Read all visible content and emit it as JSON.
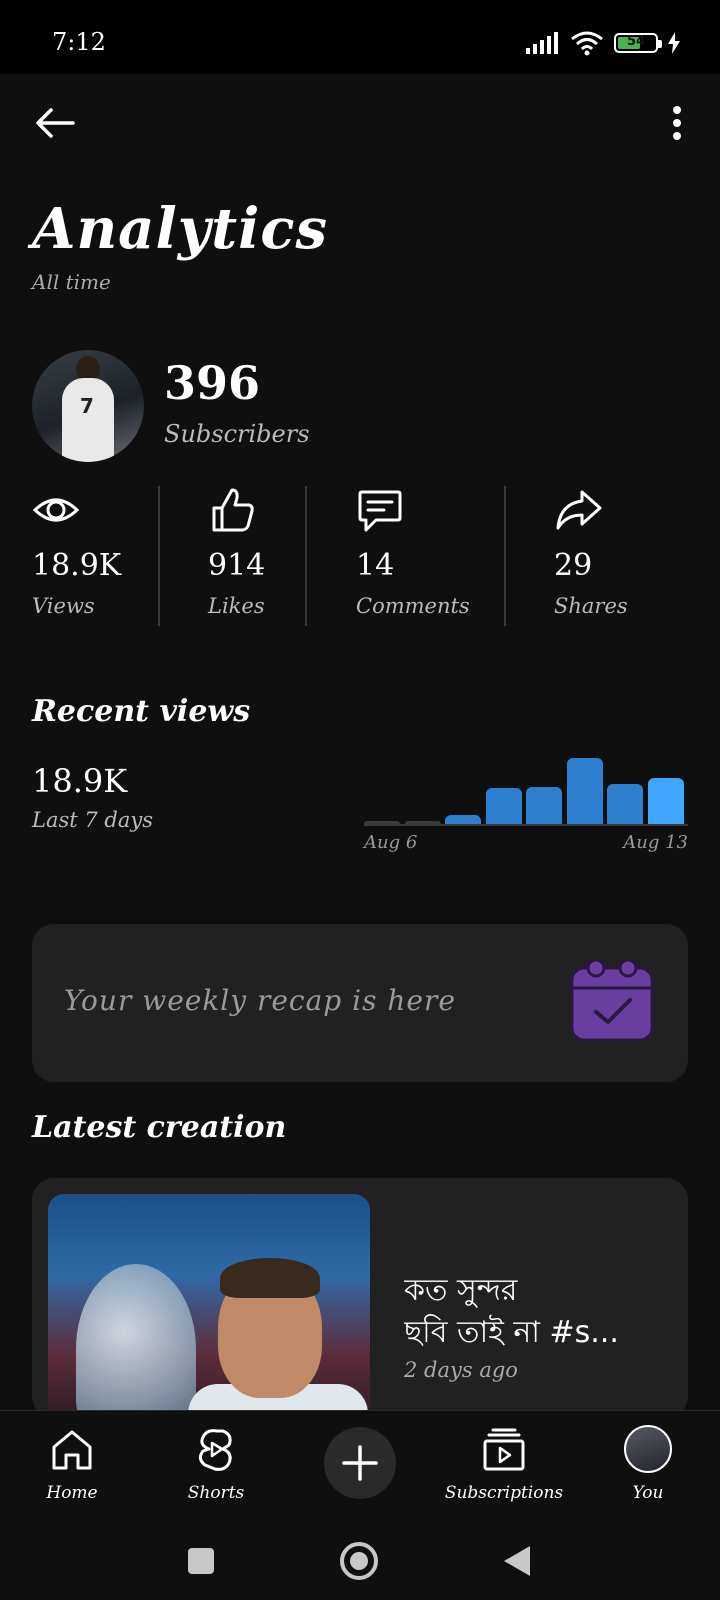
{
  "status_bar": {
    "time": "7:12",
    "battery": "54",
    "icons": [
      "signal-icon",
      "wifi-icon",
      "battery-icon",
      "charging-icon"
    ]
  },
  "header": {
    "back_icon": "arrow-left-icon",
    "more_icon": "more-vertical-icon"
  },
  "page": {
    "title": "Analytics",
    "subtitle": "All time"
  },
  "channel": {
    "subscribers_count": "396",
    "subscribers_label": "Subscribers"
  },
  "stats": [
    {
      "icon": "eye-icon",
      "value": "18.9K",
      "label": "Views"
    },
    {
      "icon": "thumbs-up-icon",
      "value": "914",
      "label": "Likes"
    },
    {
      "icon": "comment-icon",
      "value": "14",
      "label": "Comments"
    },
    {
      "icon": "share-icon",
      "value": "29",
      "label": "Shares"
    }
  ],
  "recent_views": {
    "title": "Recent views",
    "value": "18.9K",
    "period": "Last 7 days"
  },
  "chart_data": {
    "type": "bar",
    "categories": [
      "",
      "",
      "",
      "",
      "",
      "",
      "",
      ""
    ],
    "values": [
      0.02,
      0.02,
      0.13,
      0.54,
      0.56,
      1.0,
      0.6,
      0.7
    ],
    "xtick_start": "Aug 6",
    "xtick_end": "Aug 13",
    "colors": [
      "#3a3a3a",
      "#3a3a3a",
      "#2f7fd1",
      "#2f7fd1",
      "#2f7fd1",
      "#2f7fd1",
      "#2f7fd1",
      "#3ea6ff"
    ]
  },
  "recap": {
    "text": "Your weekly recap is here",
    "icon": "calendar-check-icon",
    "accent": "#6a3ea1"
  },
  "latest_creation": {
    "section_title": "Latest creation",
    "title_line1": "কত সুন্দর",
    "title_line2": "ছবি তাই না #s...",
    "age": "2 days ago"
  },
  "bottom_nav": [
    {
      "label": "Home",
      "icon": "home-icon"
    },
    {
      "label": "Shorts",
      "icon": "shorts-icon"
    },
    {
      "label": "",
      "icon": "plus-icon"
    },
    {
      "label": "Subscriptions",
      "icon": "subscriptions-icon"
    },
    {
      "label": "You",
      "icon": "avatar-icon"
    }
  ],
  "system_nav": [
    "recent-apps-icon",
    "home-circle-icon",
    "back-triangle-icon"
  ]
}
